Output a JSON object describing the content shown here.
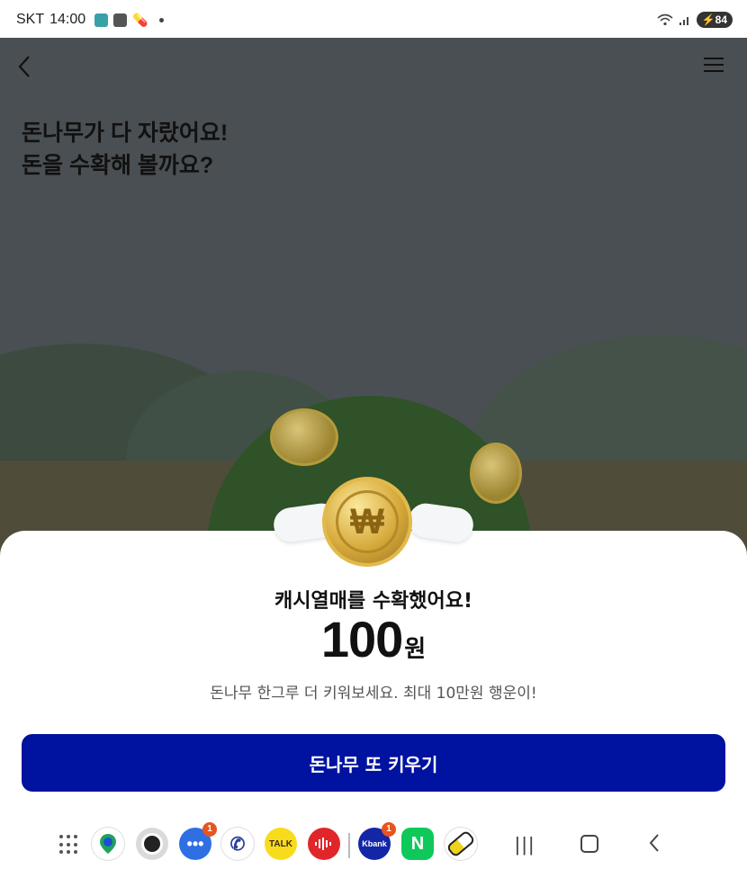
{
  "status_bar": {
    "carrier": "SKT",
    "time": "14:00",
    "battery": "84"
  },
  "nav": {
    "back_icon": "chevron-left-icon",
    "menu_icon": "hamburger-menu-icon"
  },
  "headline": {
    "line1": "돈나무가 다 자랐어요!",
    "line2": "돈을 수확해 볼까요?"
  },
  "reward": {
    "coin_symbol": "₩",
    "title": "캐시열매를 수확했어요!",
    "amount": "100",
    "unit": "원",
    "description": "돈나무 한그루 더 키워보세요. 최대 10만원 행운이!"
  },
  "cta": {
    "label": "돈나무 또 키우기"
  },
  "dock": {
    "apps": [
      {
        "name": "naver-map",
        "icon": "map-pin-icon"
      },
      {
        "name": "camera",
        "icon": "camera-icon"
      },
      {
        "name": "messages",
        "icon": "chat-icon",
        "badge": "1"
      },
      {
        "name": "phone",
        "icon": "phone-icon"
      },
      {
        "name": "kakaotalk",
        "icon": "talk-icon",
        "text": "TALK"
      },
      {
        "name": "voice-recorder",
        "icon": "sound-wave-icon"
      },
      {
        "name": "kbank",
        "icon": "kbank-icon",
        "text": "Kbank",
        "badge": "1"
      },
      {
        "name": "naver",
        "icon": "naver-icon",
        "text": "N"
      },
      {
        "name": "pill-app",
        "icon": "pill-icon"
      }
    ]
  },
  "colors": {
    "primary_button": "#0012a0",
    "scene_bg": "#4a4f53",
    "badge": "#e8541e"
  }
}
